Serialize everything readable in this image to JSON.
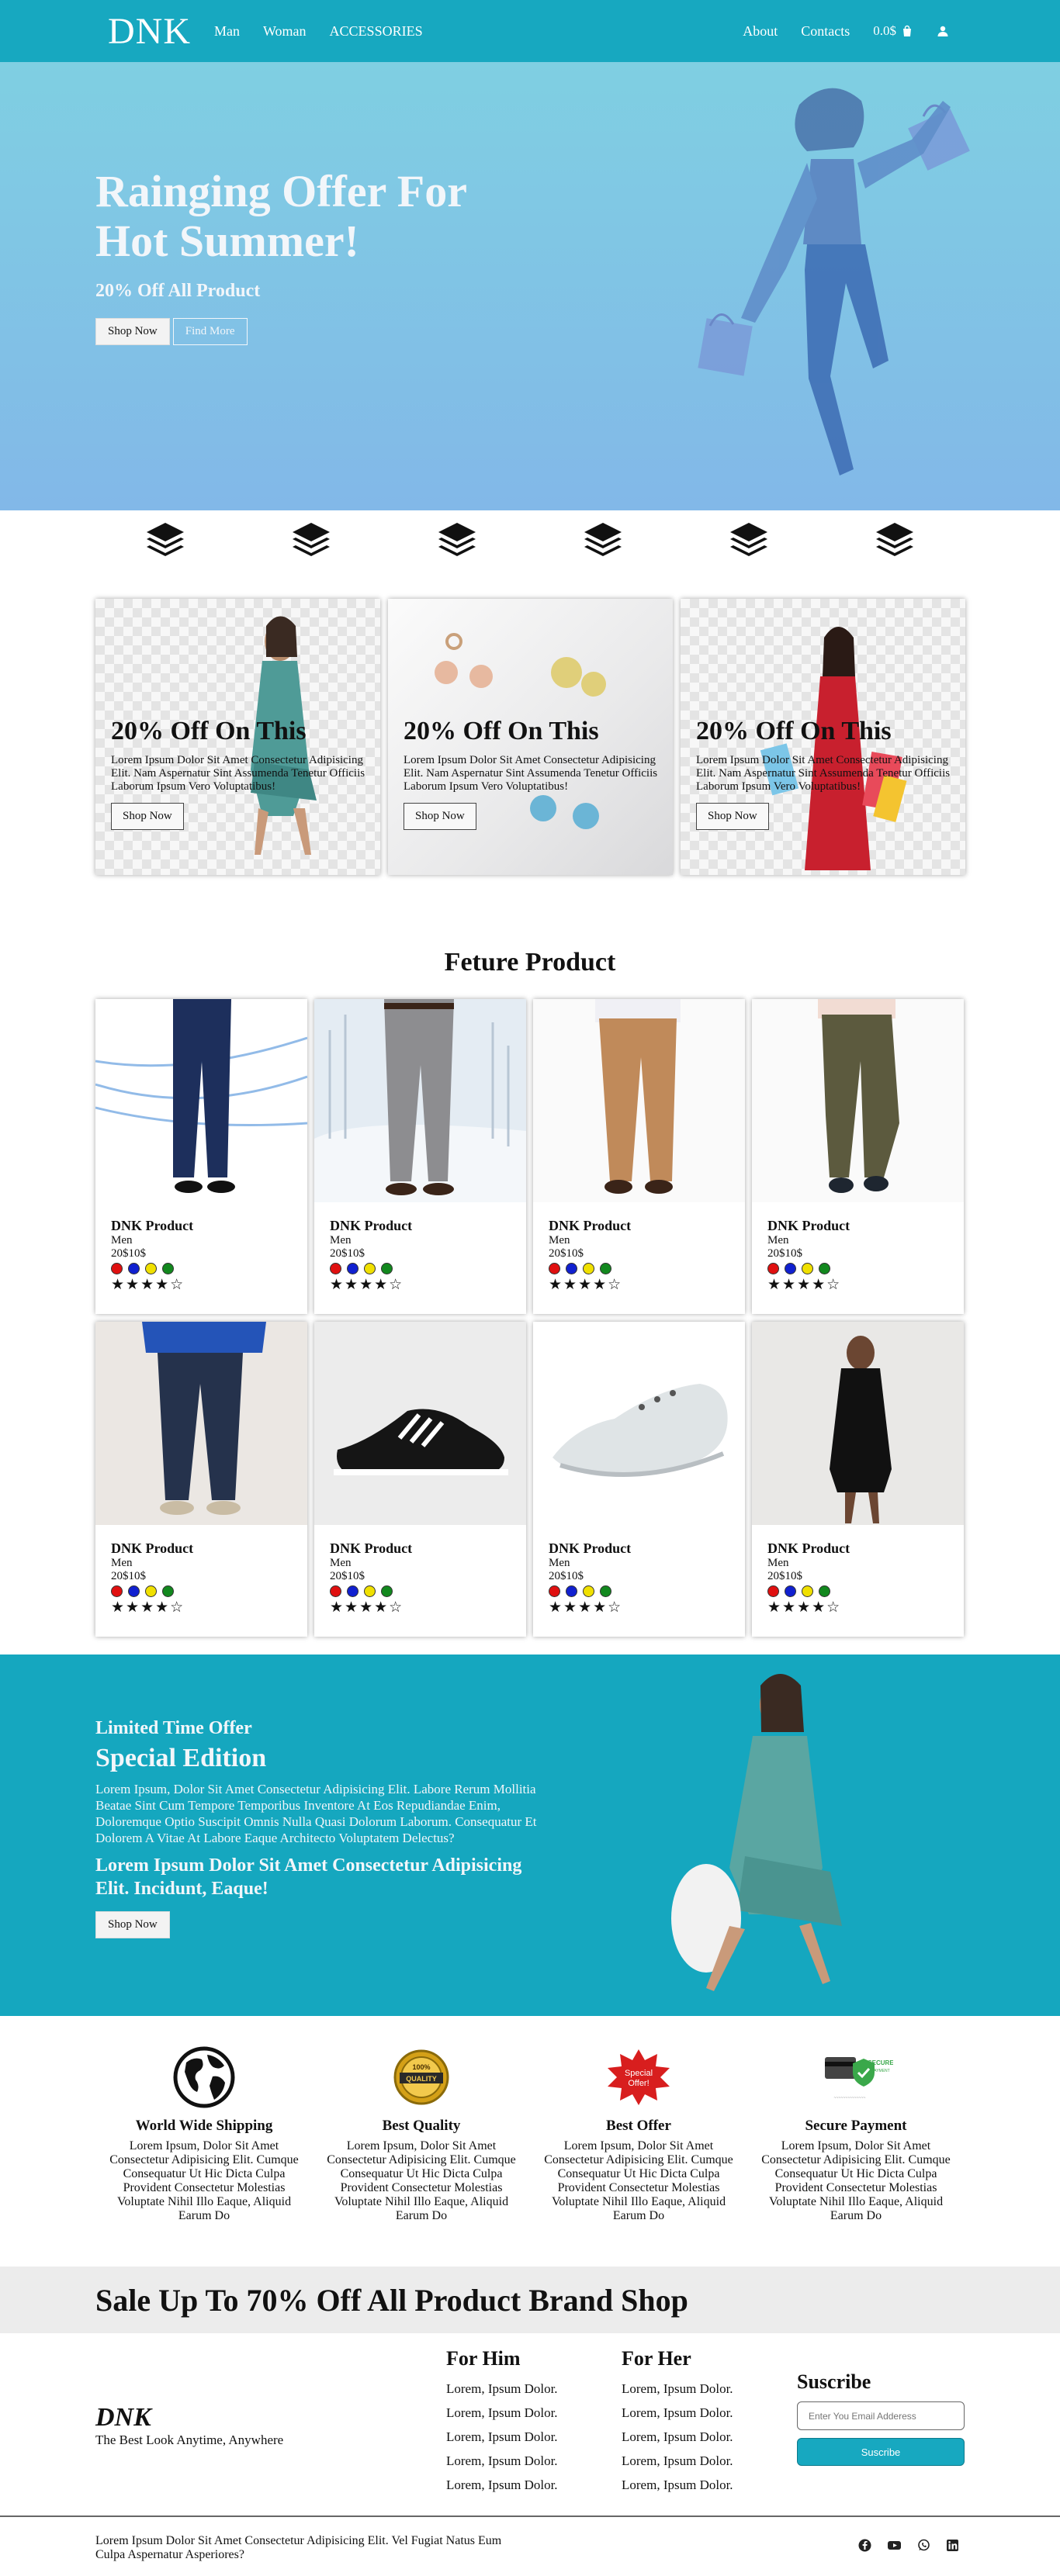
{
  "nav": {
    "logo": "DNK",
    "links": [
      "Man",
      "Woman",
      "ACCESSORIES"
    ],
    "right_links": [
      "About",
      "Contacts"
    ],
    "cart_total": "0.0$",
    "icons": {
      "cart": "shopping-bag-icon",
      "user": "user-icon"
    }
  },
  "hero": {
    "title": "Rainging Offer For Hot Summer!",
    "subtitle": "20% Off All Product",
    "primary_button": "Shop Now",
    "secondary_button": "Find More"
  },
  "icon_row": {
    "icon": "layers-icon",
    "count": 6
  },
  "offers": [
    {
      "title": "20% Off On This",
      "desc": "Lorem Ipsum Dolor Sit Amet Consectetur Adipisicing Elit. Nam Aspernatur Sint Assumenda Tenetur Officiis Laborum Ipsum Vero Voluptatibus!",
      "button": "Shop Now"
    },
    {
      "title": "20% Off On This",
      "desc": "Lorem Ipsum Dolor Sit Amet Consectetur Adipisicing Elit. Nam Aspernatur Sint Assumenda Tenetur Officiis Laborum Ipsum Vero Voluptatibus!",
      "button": "Shop Now"
    },
    {
      "title": "20% Off On This",
      "desc": "Lorem Ipsum Dolor Sit Amet Consectetur Adipisicing Elit. Nam Aspernatur Sint Assumenda Tenetur Officiis Laborum Ipsum Vero Voluptatibus!",
      "button": "Shop Now"
    }
  ],
  "featured": {
    "title": "Feture Product",
    "products": [
      {
        "name": "DNK Product",
        "category": "Men",
        "price": "20$10$",
        "rating": "★★★★☆"
      },
      {
        "name": "DNK Product",
        "category": "Men",
        "price": "20$10$",
        "rating": "★★★★☆"
      },
      {
        "name": "DNK Product",
        "category": "Men",
        "price": "20$10$",
        "rating": "★★★★☆"
      },
      {
        "name": "DNK Product",
        "category": "Men",
        "price": "20$10$",
        "rating": "★★★★☆"
      },
      {
        "name": "DNK Product",
        "category": "Men",
        "price": "20$10$",
        "rating": "★★★★☆"
      },
      {
        "name": "DNK Product",
        "category": "Men",
        "price": "20$10$",
        "rating": "★★★★☆"
      },
      {
        "name": "DNK Product",
        "category": "Men",
        "price": "20$10$",
        "rating": "★★★★☆"
      },
      {
        "name": "DNK Product",
        "category": "Men",
        "price": "20$10$",
        "rating": "★★★★☆"
      }
    ],
    "swatch_colors": [
      "#e01010",
      "#1020d0",
      "#f0e000",
      "#12881e"
    ]
  },
  "promo": {
    "kicker": "Limited Time Offer",
    "title": "Special Edition",
    "desc": "Lorem Ipsum, Dolor Sit Amet Consectetur Adipisicing Elit. Labore Rerum Mollitia Beatae Sint Cum Tempore Temporibus Inventore At Eos Repudiandae Enim, Doloremque Optio Suscipit Omnis Nulla Quasi Dolorum Laborum. Consequatur Et Dolorem A Vitae At Labore Eaque Architecto Voluptatem Delectus?",
    "subtitle": "Lorem Ipsum Dolor Sit Amet Consectetur Adipisicing Elit. Incidunt, Eaque!",
    "button": "Shop Now"
  },
  "features": [
    {
      "title": "World Wide Shipping",
      "text": "Lorem Ipsum, Dolor Sit Amet Consectetur Adipisicing Elit. Cumque Consequatur Ut Hic Dicta Culpa Provident Consectetur Molestias Voluptate Nihil Illo Eaque, Aliquid Earum Do",
      "icon": "globe-icon"
    },
    {
      "title": "Best Quality",
      "text": "Lorem Ipsum, Dolor Sit Amet Consectetur Adipisicing Elit. Cumque Consequatur Ut Hic Dicta Culpa Provident Consectetur Molestias Voluptate Nihil Illo Eaque, Aliquid Earum Do",
      "icon": "quality-badge-icon",
      "badge_top": "100%",
      "badge_main": "QUALITY"
    },
    {
      "title": "Best Offer",
      "text": "Lorem Ipsum, Dolor Sit Amet Consectetur Adipisicing Elit. Cumque Consequatur Ut Hic Dicta Culpa Provident Consectetur Molestias Voluptate Nihil Illo Eaque, Aliquid Earum Do",
      "icon": "special-offer-icon",
      "badge_line1": "Special",
      "badge_line2": "Offer!"
    },
    {
      "title": "Secure Payment",
      "text": "Lorem Ipsum, Dolor Sit Amet Consectetur Adipisicing Elit. Cumque Consequatur Ut Hic Dicta Culpa Provident Consectetur Molestias Voluptate Nihil Illo Eaque, Aliquid Earum Do",
      "icon": "secure-payment-icon",
      "badge_main": "SECURE",
      "badge_sub": "PAYMENT"
    }
  ],
  "sale_banner": "Sale Up To 70% Off All Product Brand Shop",
  "footer": {
    "logo": "DNK",
    "tagline": "The Best Look Anytime, Anywhere",
    "for_him": {
      "title": "For Him",
      "items": [
        "Lorem, Ipsum Dolor.",
        "Lorem, Ipsum Dolor.",
        "Lorem, Ipsum Dolor.",
        "Lorem, Ipsum Dolor.",
        "Lorem, Ipsum Dolor."
      ]
    },
    "for_her": {
      "title": "For Her",
      "items": [
        "Lorem, Ipsum Dolor.",
        "Lorem, Ipsum Dolor.",
        "Lorem, Ipsum Dolor.",
        "Lorem, Ipsum Dolor.",
        "Lorem, Ipsum Dolor."
      ]
    },
    "subscribe": {
      "title": "Suscribe",
      "placeholder": "Enter You Email Adderess",
      "button": "Suscribe"
    }
  },
  "bottom": {
    "text": "Lorem Ipsum Dolor Sit Amet Consectetur Adipisicing Elit. Vel Fugiat Natus Eum Culpa Aspernatur Asperiores?",
    "socials": [
      "facebook-icon",
      "youtube-icon",
      "whatsapp-icon",
      "linkedin-icon"
    ]
  },
  "colors": {
    "brand": "#17a8c0",
    "hero_top": "#7fcfe2",
    "hero_bottom": "#82b8e8"
  }
}
